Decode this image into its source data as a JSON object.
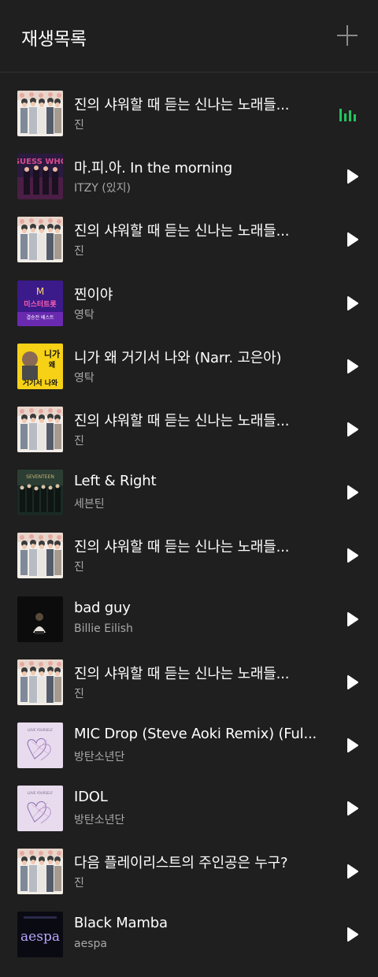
{
  "header": {
    "title": "재생목록",
    "add_icon": "plus-icon"
  },
  "colors": {
    "background": "#1f1f1f",
    "accent": "#22c55e",
    "secondary_text": "#a8a8a8"
  },
  "playlist": [
    {
      "title": "진의 샤워할 때 듣는 신나는 노래들...",
      "artist": "진",
      "art": "bts-group",
      "state": "playing"
    },
    {
      "title": "마.피.아. In the morning",
      "artist": "ITZY (있지)",
      "art": "itzy",
      "state": "play"
    },
    {
      "title": "진의 샤워할 때 듣는 신나는 노래들...",
      "artist": "진",
      "art": "bts-group",
      "state": "play"
    },
    {
      "title": "찐이야",
      "artist": "영탁",
      "art": "mistrot",
      "state": "play"
    },
    {
      "title": "니가 왜 거기서 나와 (Narr. 고은아)",
      "artist": "영탁",
      "art": "yellow-nigawae",
      "state": "play"
    },
    {
      "title": "진의 샤워할 때 듣는 신나는 노래들...",
      "artist": "진",
      "art": "bts-group",
      "state": "play"
    },
    {
      "title": "Left & Right",
      "artist": "세븐틴",
      "art": "seventeen",
      "state": "play"
    },
    {
      "title": "진의 샤워할 때 듣는 신나는 노래들...",
      "artist": "진",
      "art": "bts-group",
      "state": "play"
    },
    {
      "title": "bad guy",
      "artist": "Billie Eilish",
      "art": "billie",
      "state": "play"
    },
    {
      "title": "진의 샤워할 때 듣는 신나는 노래들...",
      "artist": "진",
      "art": "bts-group",
      "state": "play"
    },
    {
      "title": "MIC Drop (Steve Aoki Remix) (Ful...",
      "artist": "방탄소년단",
      "art": "loveyourself",
      "state": "play"
    },
    {
      "title": "IDOL",
      "artist": "방탄소년단",
      "art": "loveyourself",
      "state": "play"
    },
    {
      "title": "다음 플레이리스트의 주인공은 누구?",
      "artist": "진",
      "art": "bts-group",
      "state": "play"
    },
    {
      "title": "Black Mamba",
      "artist": "aespa",
      "art": "aespa",
      "state": "play"
    }
  ],
  "art_text": {
    "yellow-nigawae": [
      "니가",
      "왜",
      "거기서 나와"
    ],
    "mistrot": [
      "M",
      "미스터트롯",
      "결승전 베스트"
    ],
    "aespa": [
      "aespa"
    ]
  }
}
